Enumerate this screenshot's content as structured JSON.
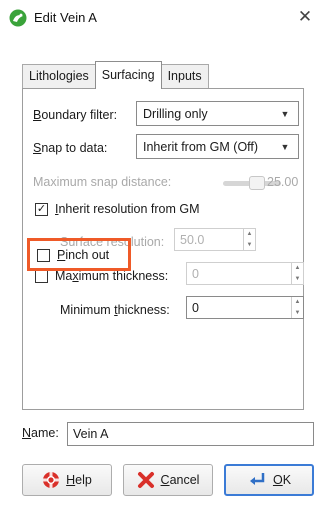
{
  "window": {
    "title": "Edit Vein A",
    "close_glyph": "✕",
    "app_icon": "leapfrog-icon"
  },
  "tabs": [
    {
      "label": "Lithologies",
      "active": false
    },
    {
      "label": "Surfacing",
      "active": true
    },
    {
      "label": "Inputs",
      "active": false
    }
  ],
  "surfacing": {
    "boundary_filter": {
      "label_ul": "B",
      "label_rest": "oundary filter:",
      "value": "Drilling only"
    },
    "snap_to_data": {
      "label_ul": "S",
      "label_rest": "nap to data:",
      "value": "Inherit from GM (Off)"
    },
    "max_snap_distance": {
      "label": "Maximum snap distance:",
      "value": "25.00"
    },
    "inherit_resolution": {
      "label_ul": "I",
      "label_rest": "nherit resolution from GM",
      "checked": true
    },
    "surface_resolution": {
      "label": "Surface resolution:",
      "value": "50.0"
    },
    "maximum_thickness": {
      "label_pre": "Ma",
      "label_ul": "x",
      "label_rest": "imum thickness:",
      "value": "0",
      "checked": false
    },
    "minimum_thickness": {
      "label_pre": "Minimum ",
      "label_ul": "t",
      "label_rest": "hickness:",
      "value": "0"
    },
    "pinch_out": {
      "label_ul": "P",
      "label_rest": "inch out",
      "checked": false
    }
  },
  "name_field": {
    "label_ul": "N",
    "label_rest": "ame:",
    "value": "Vein A"
  },
  "buttons": {
    "help": {
      "label_ul": "H",
      "label_rest": "elp"
    },
    "cancel": {
      "label_ul": "C",
      "label_rest": "ancel"
    },
    "ok": {
      "label_ul": "O",
      "label_rest": "K"
    }
  },
  "colors": {
    "highlight": "#ef5a28",
    "default_button_border": "#3b7bd6"
  }
}
